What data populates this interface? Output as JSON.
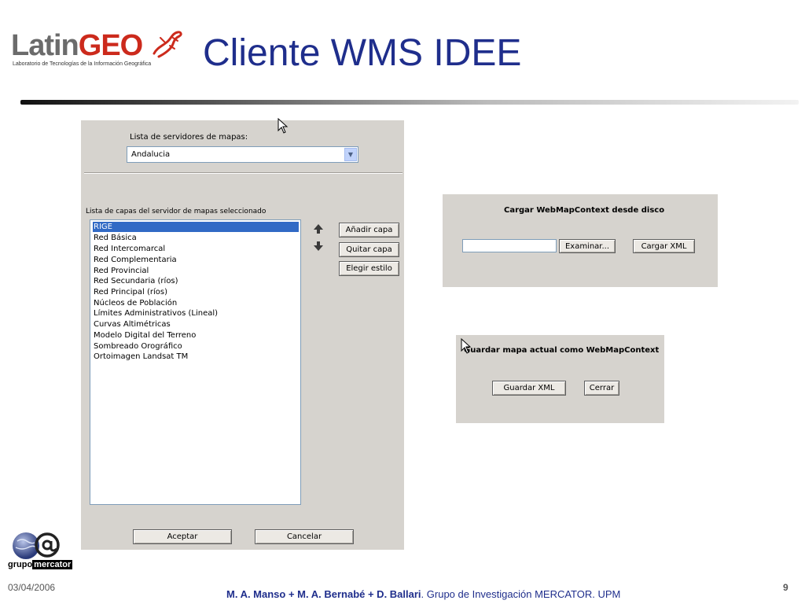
{
  "header": {
    "logo_main": "Latin",
    "logo_accent": "GEO",
    "logo_subtitle": "Laboratorio de Tecnologías de la Información Geográfica",
    "title": "Cliente WMS IDEE"
  },
  "main_panel": {
    "server_list_label": "Lista de servidores de mapas:",
    "server_selected": "Andalucia",
    "layers_label": "Lista de capas del servidor de mapas seleccionado",
    "layers": [
      "RIGE",
      "Red Básica",
      "Red Intercomarcal",
      "Red Complementaria",
      "Red Provincial",
      "Red Secundaria (ríos)",
      "Red Principal (ríos)",
      "Núcleos de Población",
      "Límites Administrativos (Lineal)",
      "Curvas Altimétricas",
      "Modelo Digital del Terreno",
      "Sombreado Orográfico",
      "Ortoimagen Landsat TM"
    ],
    "add_layer_button": "Añadir capa",
    "remove_layer_button": "Quitar capa",
    "choose_style_button": "Elegir estilo",
    "accept_button": "Aceptar",
    "cancel_button": "Cancelar"
  },
  "load_panel": {
    "title": "Cargar WebMapContext desde disco",
    "file_value": "",
    "browse_button": "Examinar...",
    "load_button": "Cargar XML"
  },
  "save_panel": {
    "title": "Guardar mapa actual como WebMapContext",
    "save_button": "Guardar XML",
    "close_button": "Cerrar"
  },
  "footer": {
    "logo_left": "grupo",
    "logo_right": "mercator",
    "date": "03/04/2006",
    "authors": "M. A. Manso + M. A. Bernabé + D. Ballari",
    "group": ". Grupo de Investigación MERCATOR. UPM",
    "page_number": "9"
  },
  "colors": {
    "title_blue": "#1f2e8c",
    "logo_red": "#cc2a1c",
    "panel_bg": "#d6d3ce",
    "selection_blue": "#316ac5"
  }
}
